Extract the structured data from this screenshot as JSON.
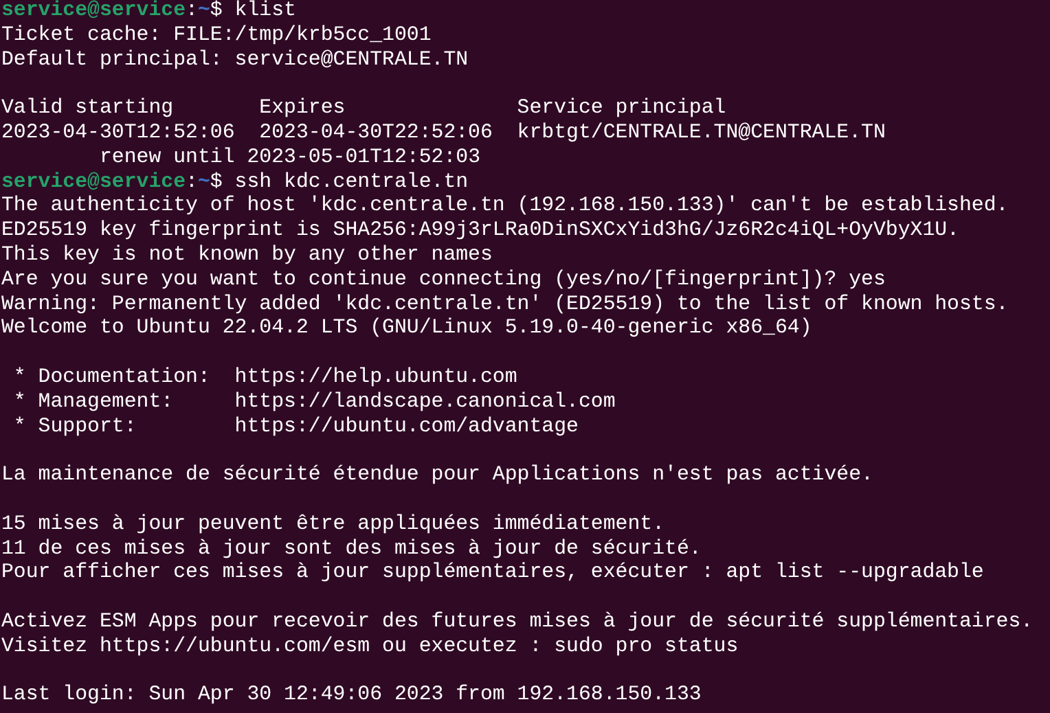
{
  "terminal": {
    "lines": [
      {
        "kind": "prompt",
        "user_host": "service@service",
        "separator": ":",
        "path": "~",
        "symbol": "$",
        "command": "klist"
      },
      {
        "kind": "output",
        "text": "Ticket cache: FILE:/tmp/krb5cc_1001"
      },
      {
        "kind": "output",
        "text": "Default principal: service@CENTRALE.TN"
      },
      {
        "kind": "blank"
      },
      {
        "kind": "output",
        "text": "Valid starting       Expires              Service principal"
      },
      {
        "kind": "output",
        "text": "2023-04-30T12:52:06  2023-04-30T22:52:06  krbtgt/CENTRALE.TN@CENTRALE.TN"
      },
      {
        "kind": "output",
        "text": "\trenew until 2023-05-01T12:52:03"
      },
      {
        "kind": "prompt",
        "user_host": "service@service",
        "separator": ":",
        "path": "~",
        "symbol": "$",
        "command": "ssh kdc.centrale.tn"
      },
      {
        "kind": "output",
        "text": "The authenticity of host 'kdc.centrale.tn (192.168.150.133)' can't be established."
      },
      {
        "kind": "output",
        "text": "ED25519 key fingerprint is SHA256:A99j3rLRa0DinSXCxYid3hG/Jz6R2c4iQL+OyVbyX1U."
      },
      {
        "kind": "output",
        "text": "This key is not known by any other names"
      },
      {
        "kind": "output",
        "text": "Are you sure you want to continue connecting (yes/no/[fingerprint])? yes"
      },
      {
        "kind": "output",
        "text": "Warning: Permanently added 'kdc.centrale.tn' (ED25519) to the list of known hosts."
      },
      {
        "kind": "output",
        "text": "Welcome to Ubuntu 22.04.2 LTS (GNU/Linux 5.19.0-40-generic x86_64)"
      },
      {
        "kind": "blank"
      },
      {
        "kind": "output",
        "text": " * Documentation:  https://help.ubuntu.com"
      },
      {
        "kind": "output",
        "text": " * Management:     https://landscape.canonical.com"
      },
      {
        "kind": "output",
        "text": " * Support:        https://ubuntu.com/advantage"
      },
      {
        "kind": "blank"
      },
      {
        "kind": "output",
        "text": "La maintenance de sécurité étendue pour Applications n'est pas activée."
      },
      {
        "kind": "blank"
      },
      {
        "kind": "output",
        "text": "15 mises à jour peuvent être appliquées immédiatement."
      },
      {
        "kind": "output",
        "text": "11 de ces mises à jour sont des mises à jour de sécurité."
      },
      {
        "kind": "output",
        "text": "Pour afficher ces mises à jour supplémentaires, exécuter : apt list --upgradable"
      },
      {
        "kind": "blank"
      },
      {
        "kind": "output",
        "text": "Activez ESM Apps pour recevoir des futures mises à jour de sécurité supplémentaires."
      },
      {
        "kind": "output",
        "text": "Visitez https://ubuntu.com/esm ou executez : sudo pro status"
      },
      {
        "kind": "blank"
      },
      {
        "kind": "output",
        "text": "Last login: Sun Apr 30 12:49:06 2023 from 192.168.150.133"
      }
    ]
  }
}
